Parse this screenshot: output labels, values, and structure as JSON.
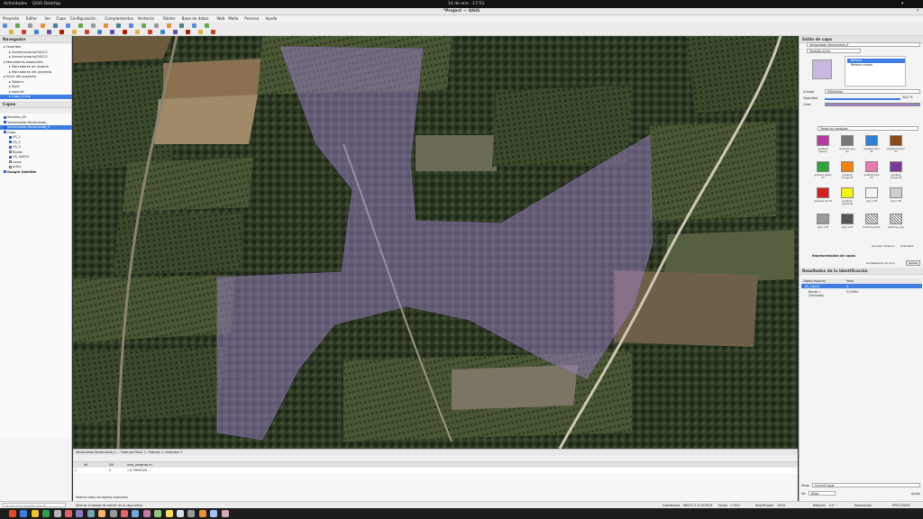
{
  "gnome": {
    "activities": "Actividades",
    "app": "QGIS Desktop",
    "clock": "14 de ene - 17:53"
  },
  "window": {
    "title": "*Project — QGIS"
  },
  "menu": [
    "Proyecto",
    "Editar",
    "Ver",
    "Capa",
    "Configuración",
    "Complementos",
    "Vectorial",
    "Ráster",
    "Base de datos",
    "Web",
    "Malla",
    "Proceso",
    "Ayuda"
  ],
  "browser": {
    "title": "Navegador",
    "items": [
      "Favoritos",
      "/home/usuario/GIS/CG",
      "/home/usuario/GIS/CG",
      "Marcadores espaciales",
      "Marcadores de usuario",
      "Marcadores del proyecto",
      "Inicio del proyecto",
      "Tablero",
      "layer",
      "layer.tif",
      "Capa_0.shp"
    ]
  },
  "layers": {
    "title": "Capas",
    "items": [
      {
        "label": "Muestra_49",
        "checked": true,
        "selected": false
      },
      {
        "label": "Vectorizado Vectorizado_",
        "checked": true,
        "selected": false
      },
      {
        "label": "Vectorizado Vectorizado_0",
        "checked": true,
        "selected": true
      },
      {
        "label": "Capa",
        "checked": true,
        "selected": false
      },
      {
        "label": "VS_1",
        "checked": true,
        "selected": false
      },
      {
        "label": "VS_2",
        "checked": true,
        "selected": false
      },
      {
        "label": "VS_3",
        "checked": true,
        "selected": false
      },
      {
        "label": "Raster",
        "checked": false,
        "selected": false
      },
      {
        "label": "VS_34053",
        "checked": true,
        "selected": false
      },
      {
        "label": "Layer",
        "checked": false,
        "selected": false
      },
      {
        "label": "ortho",
        "checked": false,
        "selected": false
      },
      {
        "label": "Google Satellite",
        "checked": true,
        "selected": false
      }
    ]
  },
  "style_panel": {
    "title": "Estilo de capa",
    "layer_select": "Vectorizado Vectorizado_0",
    "renderer": "Símbolo único",
    "tree_root": "Relleno",
    "tree_child": "Relleno simple",
    "unit_label": "Unidad",
    "unit_value": "Milímetros",
    "opacity_label": "Opacidad",
    "opacity_value": "50,0 %",
    "color_label": "Color",
    "fill_color": "#9b7fc8",
    "favorites": "Todos los símbolos",
    "swatches": [
      {
        "name": "gradient plasma",
        "color": "#b83aa0"
      },
      {
        "name": "gradient gray fill",
        "color": "#777777"
      },
      {
        "name": "gradient blue fill",
        "color": "#2f7fd6"
      },
      {
        "name": "gradient brown fill",
        "color": "#8a4a1c"
      },
      {
        "name": "gradient green fill",
        "color": "#2fa43a"
      },
      {
        "name": "gradient orange fill",
        "color": "#f0820f"
      },
      {
        "name": "gradient pink fill",
        "color": "#e87ab4"
      },
      {
        "name": "gradient purple fill",
        "color": "#7a3a9a"
      },
      {
        "name": "gradient red fill",
        "color": "#d62020"
      },
      {
        "name": "gradient yellow fill",
        "color": "#f6f01a"
      },
      {
        "name": "gray 1 fill",
        "color": "#f4f4f4"
      },
      {
        "name": "gray 2 fill",
        "color": "#cfcfcf"
      },
      {
        "name": "gray 3 fill",
        "color": "#9a9a9a"
      },
      {
        "name": "gray 4 fill",
        "color": "#555555"
      },
      {
        "name": "hatching black",
        "color": "#ffffff"
      },
      {
        "name": "hatching gray",
        "color": "#ffffff"
      }
    ],
    "save_symbol": "Guardar símbolo...",
    "advanced": "Avanzado",
    "layer_render": "Representación de capas",
    "live_update": "Actualización en vivo",
    "apply": "Aplicar"
  },
  "identify": {
    "title": "Resultados de la identificación",
    "col_feature": "Objeto espacial",
    "col_value": "Valor",
    "row_layer": "VS_34053",
    "row_layer_val": "0",
    "row_band": "Banda 1",
    "row_band_val": "5,51064",
    "row_derived": "(Derivado)"
  },
  "attr_table": {
    "title": "Vectorizado Vectorizado_0 — Features Total: 1, Filtered: 1, Selected: 0",
    "columns": [
      "fid",
      "DN",
      "area_(ortgmas m..."
    ],
    "rows": [
      [
        "1",
        "0",
        "1  6,75656105 ..."
      ]
    ],
    "show_all": "Mostrar todos los objetos espaciales"
  },
  "status": {
    "locator": "Escribir para localizar (Ctrl+K)",
    "hint": "Alternar el estado de edición de la capa activa",
    "coord_label": "Coordenada",
    "coord": "788472,3  4715939,8",
    "scale_label": "Escala",
    "scale": "1:7001",
    "mag_label": "Amplificador",
    "mag": "100%",
    "rot_label": "Rotación",
    "rot": "0,0 °",
    "render": "Representar",
    "crs": "EPSG:25830"
  },
  "right_bottom": {
    "mode_label": "Modo",
    "mode": "Current Layer",
    "view_label": "Ver",
    "view": "Árbol",
    "help": "Ayuda"
  }
}
